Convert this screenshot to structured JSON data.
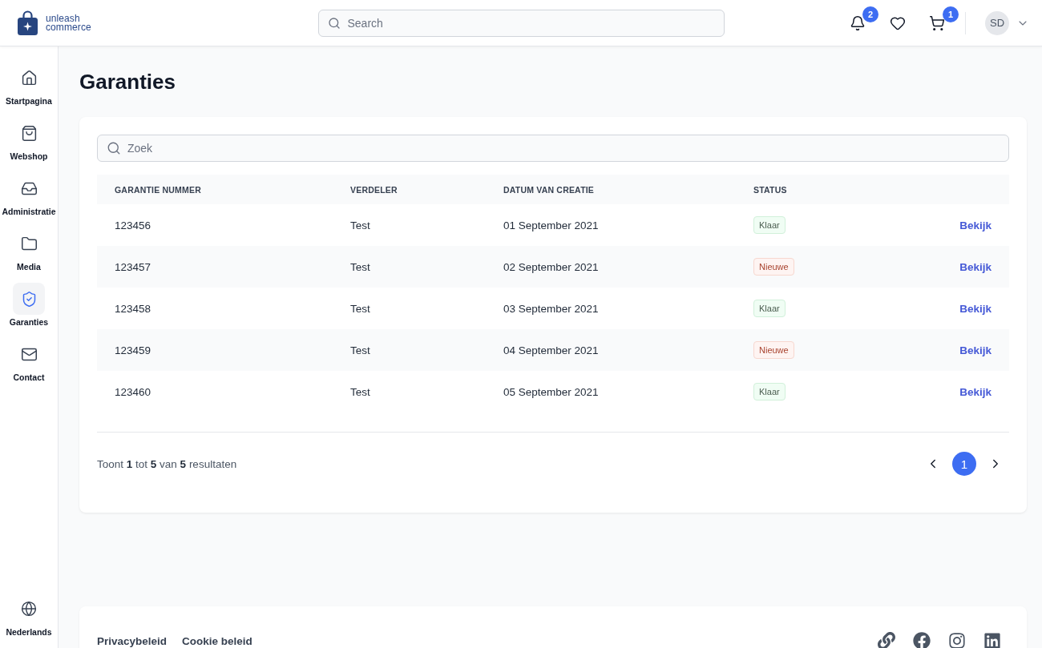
{
  "header": {
    "logo": {
      "line_1": "unleash",
      "line_2": "commerce"
    },
    "search": {
      "placeholder": "Search"
    },
    "notifications": {
      "count": "2"
    },
    "cart": {
      "count": "1"
    },
    "user": {
      "initials": "SD"
    }
  },
  "sidebar": {
    "items": [
      {
        "label": "Startpagina",
        "selected": false
      },
      {
        "label": "Webshop",
        "selected": false
      },
      {
        "label": "Administratie",
        "selected": false
      },
      {
        "label": "Media",
        "selected": false
      },
      {
        "label": "Garanties",
        "selected": true
      },
      {
        "label": "Contact",
        "selected": false
      }
    ],
    "language": {
      "label": "Nederlands"
    }
  },
  "page": {
    "title": "Garanties",
    "search": {
      "placeholder": "Zoek"
    },
    "table": {
      "columns": [
        "GARANTIE NUMMER",
        "VERDELER",
        "DATUM VAN CREATIE",
        "STATUS"
      ],
      "rows": [
        {
          "number": "123456",
          "distributor": "Test",
          "date": "01 September 2021",
          "status": {
            "label": "Klaar",
            "kind": "done"
          },
          "action": "Bekijk"
        },
        {
          "number": "123457",
          "distributor": "Test",
          "date": "02 September 2021",
          "status": {
            "label": "Nieuwe",
            "kind": "new"
          },
          "action": "Bekijk"
        },
        {
          "number": "123458",
          "distributor": "Test",
          "date": "03 September 2021",
          "status": {
            "label": "Klaar",
            "kind": "done"
          },
          "action": "Bekijk"
        },
        {
          "number": "123459",
          "distributor": "Test",
          "date": "04 September 2021",
          "status": {
            "label": "Nieuwe",
            "kind": "new"
          },
          "action": "Bekijk"
        },
        {
          "number": "123460",
          "distributor": "Test",
          "date": "05 September 2021",
          "status": {
            "label": "Klaar",
            "kind": "done"
          },
          "action": "Bekijk"
        }
      ]
    },
    "summary": "Toont **1** tot **5** van **5** resultaten",
    "pagination": {
      "pages": [
        {
          "label": "1",
          "selected": true
        }
      ]
    }
  },
  "footer": {
    "links": [
      "Privacybeleid",
      "Cookie beleid"
    ]
  }
}
